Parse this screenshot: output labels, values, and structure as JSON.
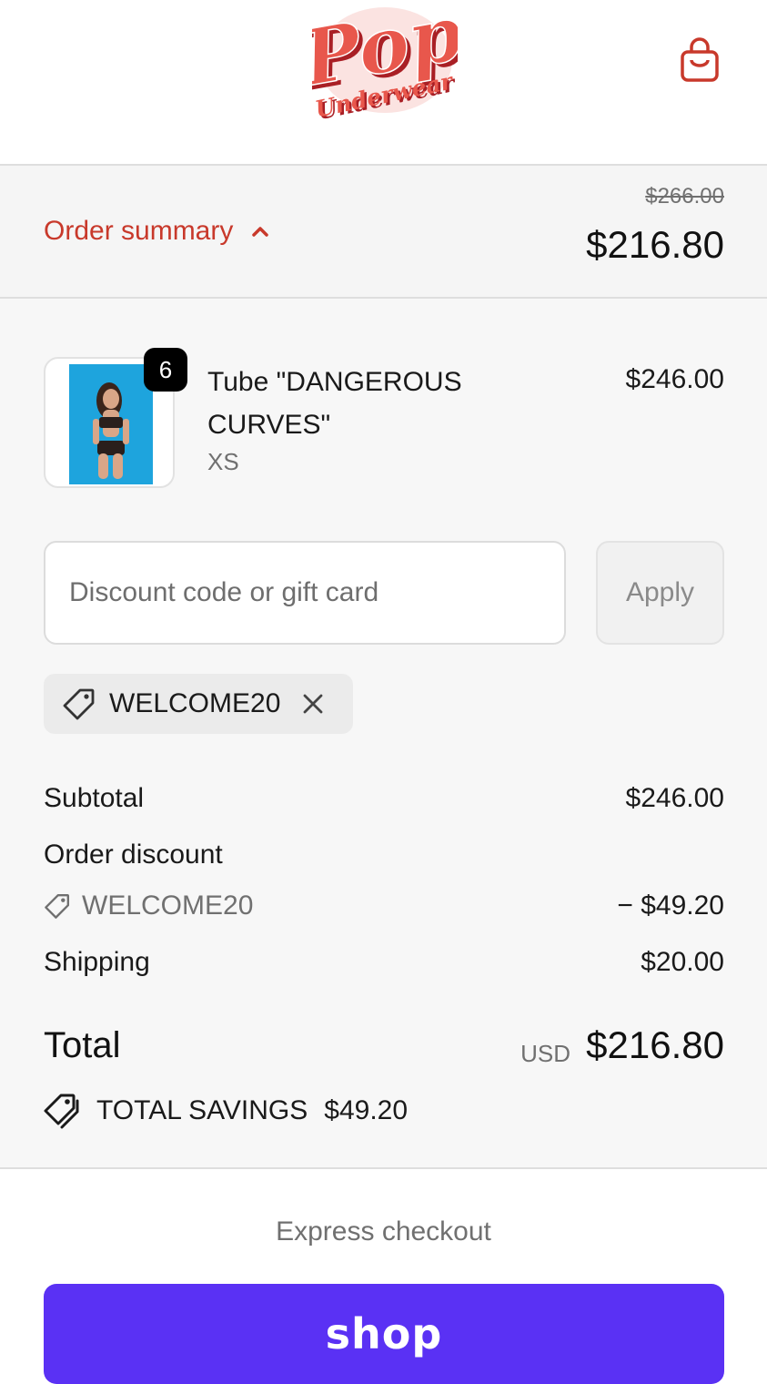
{
  "brand": {
    "logo_text": "Pop",
    "logo_subtext": "Underwear",
    "logo_color": "#e8574c",
    "logo_shadow_color": "#a91f25"
  },
  "header": {
    "cart_icon": "shopping-bag-icon"
  },
  "summary_bar": {
    "toggle_label": "Order summary",
    "toggle_icon": "chevron-up-icon",
    "original_total": "$266.00",
    "total": "$216.80",
    "accent_color": "#c8392b"
  },
  "line_item": {
    "quantity": "6",
    "name": "Tube \"DANGEROUS CURVES\"",
    "variant": "XS",
    "price": "$246.00"
  },
  "discount": {
    "placeholder": "Discount code or gift card",
    "value": "",
    "apply_label": "Apply",
    "applied_code": "WELCOME20",
    "tag_icon": "tag-icon",
    "remove_icon": "close-icon"
  },
  "totals": {
    "subtotal_label": "Subtotal",
    "subtotal_value": "$246.00",
    "order_discount_label": "Order discount",
    "discount_code": "WELCOME20",
    "discount_value": "− $49.20",
    "shipping_label": "Shipping",
    "shipping_value": "$20.00",
    "total_label": "Total",
    "currency": "USD",
    "total_value": "$216.80",
    "savings_label": "TOTAL SAVINGS",
    "savings_value": "$49.20",
    "savings_icon": "tags-icon"
  },
  "express": {
    "title": "Express checkout",
    "shop_pay_label": "shop",
    "shop_pay_color": "#5a31f4"
  }
}
